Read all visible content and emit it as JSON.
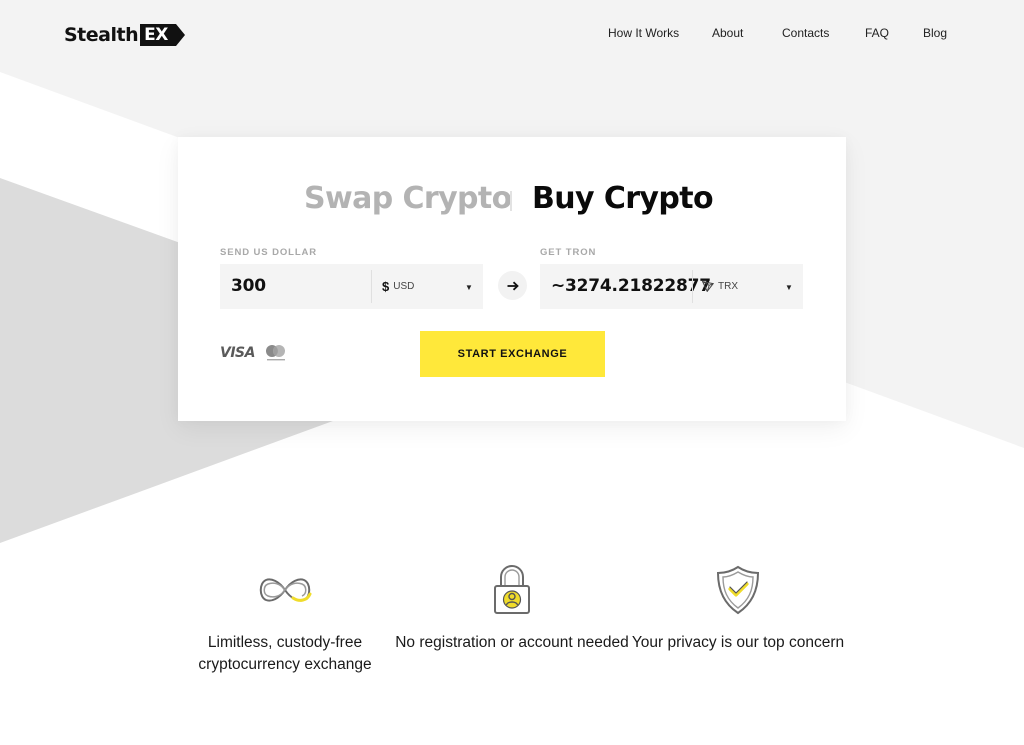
{
  "brand": {
    "name_prefix": "Stealth",
    "name_badge": "EX"
  },
  "nav": {
    "items": [
      {
        "label": "How It Works"
      },
      {
        "label": "About"
      },
      {
        "label": "Contacts"
      },
      {
        "label": "FAQ"
      },
      {
        "label": "Blog"
      }
    ]
  },
  "exchange": {
    "tabs": [
      {
        "label": "Swap Crypto",
        "active": false
      },
      {
        "label": "Buy Crypto",
        "active": true
      }
    ],
    "send": {
      "label": "SEND US DOLLAR",
      "amount": "300",
      "currency_symbol": "$",
      "currency_code": "USD",
      "icon": "dollar-icon"
    },
    "swap_icon": "arrow-right-icon",
    "get": {
      "label": "GET TRON",
      "amount": "~3274.21822877",
      "currency_code": "TRX",
      "icon": "tron-icon"
    },
    "payment_methods": [
      "VISA",
      "mastercard"
    ],
    "cta_label": "START EXCHANGE"
  },
  "features": [
    {
      "icon": "infinity-icon",
      "text": "Limitless, custody-free cryptocurrency exchange"
    },
    {
      "icon": "lock-user-icon",
      "text": "No registration or account needed"
    },
    {
      "icon": "shield-check-icon",
      "text": "Your privacy is our top concern"
    }
  ],
  "colors": {
    "accent": "#ffe83a",
    "background_light": "#f3f3f3",
    "background_dark": "#dcdcdc",
    "tab_inactive": "#b3b3b3",
    "text_primary": "#111111"
  }
}
